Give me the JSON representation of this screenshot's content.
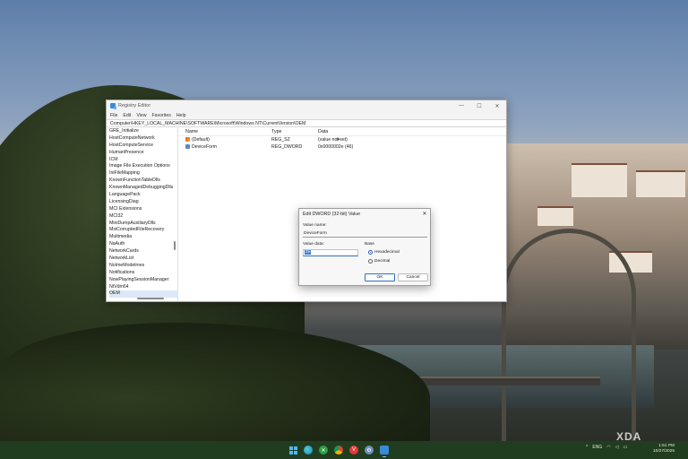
{
  "colors": {
    "accent": "#2f6fc0",
    "selection": "#3a7bd5",
    "taskbar": "#213d1f",
    "window_bg": "#ffffff"
  },
  "regedit": {
    "title": "Registry Editor",
    "window_controls": {
      "minimize": "—",
      "maximize": "☐",
      "close": "✕"
    },
    "menu": [
      "File",
      "Edit",
      "View",
      "Favorites",
      "Help"
    ],
    "address": "Computer\\HKEY_LOCAL_MACHINE\\SOFTWARE\\Microsoft\\Windows NT\\CurrentVersion\\OEM",
    "tree": [
      "GRE_Initialize",
      "HostComputeNetwork",
      "HostComputeService",
      "HumanPresence",
      "ICM",
      "Image File Execution Options",
      "IniFileMapping",
      "KnownFunctionTableDlls",
      "KnownManagedDebuggingDlls",
      "LanguagePack",
      "LicensingDiag",
      "MCI Extensions",
      "MCI32",
      "MiniDumpAuxiliaryDlls",
      "MsiCorruptedFileRecovery",
      "Multimedia",
      "NaAuth",
      "NetworkCards",
      "NetworkList",
      "NoImeModelmes",
      "Notifications",
      "NowPlayingSessionManager",
      "NtVdm64",
      "OEM"
    ],
    "tree_selected": "OEM",
    "columns": {
      "name": "Name",
      "type": "Type",
      "data": "Data"
    },
    "values": [
      {
        "name": "(Default)",
        "type": "REG_SZ",
        "data": "(value not set)",
        "icon": "string-value-icon"
      },
      {
        "name": "DeviceForm",
        "type": "REG_DWORD",
        "data": "0x0000002e (46)",
        "icon": "dword-value-icon"
      }
    ]
  },
  "dialog": {
    "title": "Edit DWORD (32-bit) Value",
    "close": "✕",
    "value_name_label": "Value name:",
    "value_name": "DeviceForm",
    "value_data_label": "Value data:",
    "value_data": "2e",
    "base_label": "Base",
    "base_options": [
      {
        "label": "Hexadecimal",
        "checked": true
      },
      {
        "label": "Decimal",
        "checked": false
      }
    ],
    "ok": "OK",
    "cancel": "Cancel"
  },
  "taskbar": {
    "apps": [
      "start-icon",
      "edge-icon",
      "xbox-icon",
      "chrome-icon",
      "vivaldi-icon",
      "settings-icon",
      "regedit-icon"
    ],
    "tray": {
      "chevron": "^",
      "language": "ENG"
    },
    "time": "1:51 PM",
    "date": "10/27/2025"
  },
  "watermark": "XDA"
}
